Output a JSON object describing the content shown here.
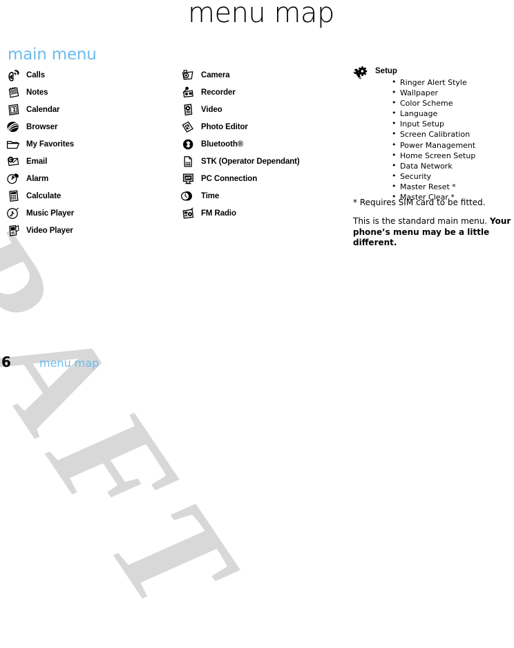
{
  "page": {
    "title": "menu map",
    "section_heading": "main menu",
    "accent_color": "#6cbbee",
    "text_color": "#000000",
    "watermark_text": "DRAFT",
    "watermark_color": "#d8d8d8"
  },
  "columns": [
    {
      "id": "column-1",
      "items": [
        {
          "label": "Calls",
          "icon": "calls-icon"
        },
        {
          "label": "Notes",
          "icon": "notes-icon"
        },
        {
          "label": "Calendar",
          "icon": "calendar-icon"
        },
        {
          "label": "Browser",
          "icon": "browser-icon"
        },
        {
          "label": "My Favorites",
          "icon": "folder-icon"
        },
        {
          "label": "Email",
          "icon": "email-icon"
        },
        {
          "label": "Alarm",
          "icon": "alarm-clock-icon"
        },
        {
          "label": "Calculate",
          "icon": "calculator-icon"
        },
        {
          "label": "Music Player",
          "icon": "music-player-icon"
        },
        {
          "label": "Video Player",
          "icon": "video-player-icon"
        }
      ]
    },
    {
      "id": "column-2",
      "items": [
        {
          "label": "Camera",
          "icon": "camera-icon"
        },
        {
          "label": "Recorder",
          "icon": "recorder-icon"
        },
        {
          "label": "Video",
          "icon": "video-icon"
        },
        {
          "label": "Photo Editor",
          "icon": "photo-editor-icon"
        },
        {
          "label": "Bluetooth®",
          "icon": "bluetooth-icon"
        },
        {
          "label": "STK (Operator Dependant)",
          "icon": "sim-card-icon"
        },
        {
          "label": "PC Connection",
          "icon": "pc-connection-icon"
        },
        {
          "label": "Time",
          "icon": "time-icon"
        },
        {
          "label": "FM Radio",
          "icon": "fm-radio-icon"
        }
      ]
    }
  ],
  "setup": {
    "icon": "settings-gear-icon",
    "title": "Setup",
    "items": [
      "Ringer Alert Style",
      "Wallpaper",
      "Color Scheme",
      "Language",
      "Input Setup",
      "Screen Calibration",
      "Power Management",
      "Home Screen Setup",
      "Data Network",
      "Security",
      "Master Reset *",
      "Master Clear *"
    ]
  },
  "notes": {
    "sim_note": "* Requires SIM card to be fitted.",
    "standard_note_plain": "This is the standard main menu. ",
    "standard_note_bold": "Your phone’s menu may be a little different."
  },
  "footer": {
    "page_number": "6",
    "section_label": "menu map"
  }
}
